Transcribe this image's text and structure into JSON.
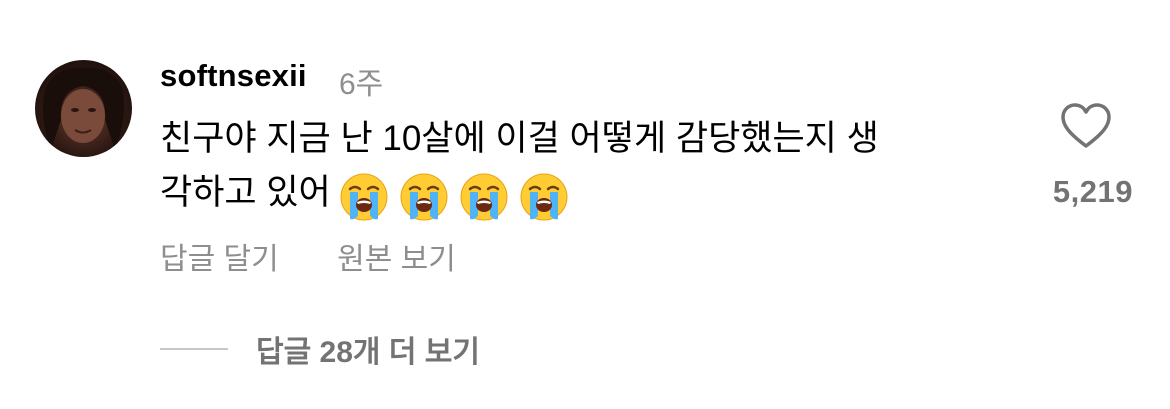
{
  "comment": {
    "username": "softnsexii",
    "time": "6주",
    "text_line1": "친구야 지금 난 10살에 이걸 어떻게 감당했는지 생",
    "text_line2": "각하고 있어",
    "emojis": [
      "loudly-crying-face",
      "loudly-crying-face",
      "loudly-crying-face",
      "loudly-crying-face"
    ],
    "like_count": "5,219",
    "reply_label": "답글 달기",
    "see_original_label": "원본 보기"
  },
  "replies": {
    "more_label": "답글 28개 더 보기"
  },
  "colors": {
    "text": "#000000",
    "secondary_text": "#8e8e8e",
    "count_text": "#737373",
    "divider": "#c7c7c7"
  }
}
